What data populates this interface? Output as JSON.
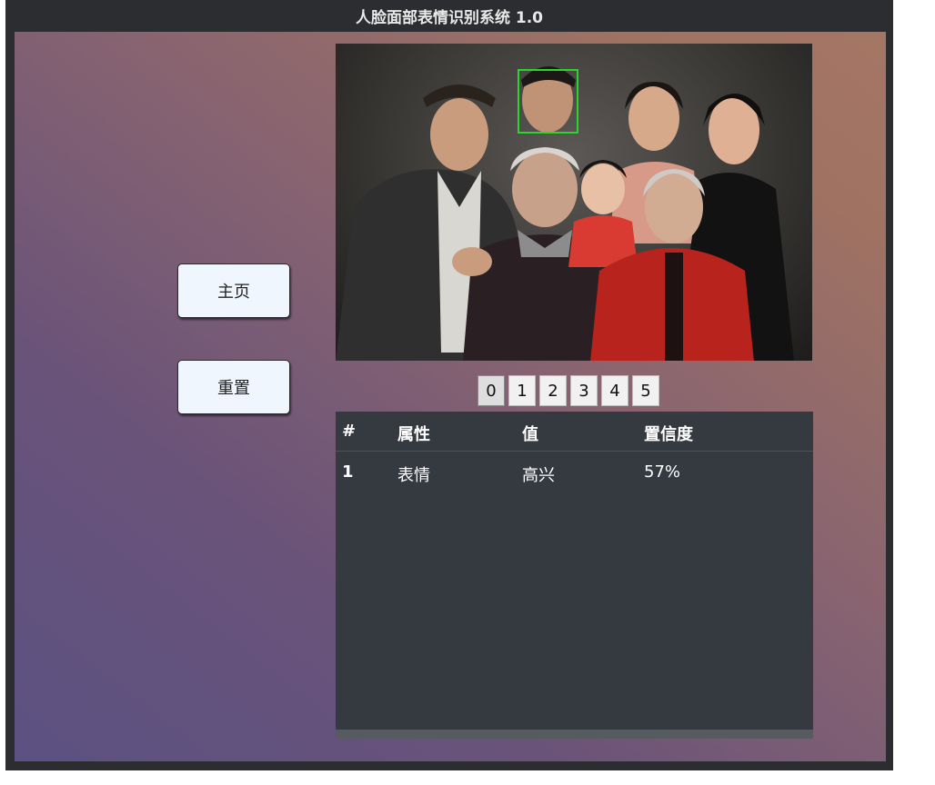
{
  "window": {
    "title": "人脸面部表情识别系统 1.0"
  },
  "nav": {
    "home_label": "主页",
    "reset_label": "重置"
  },
  "face_tabs": [
    "0",
    "1",
    "2",
    "3",
    "4",
    "5"
  ],
  "selected_face": "0",
  "results": {
    "headers": [
      "#",
      "属性",
      "值",
      "置信度"
    ],
    "rows": [
      [
        "1",
        "表情",
        "高兴",
        "57%"
      ]
    ]
  },
  "colors": {
    "detection_box": "#29d629",
    "table_bg": "#343a40",
    "button_bg": "#eff6fd"
  }
}
